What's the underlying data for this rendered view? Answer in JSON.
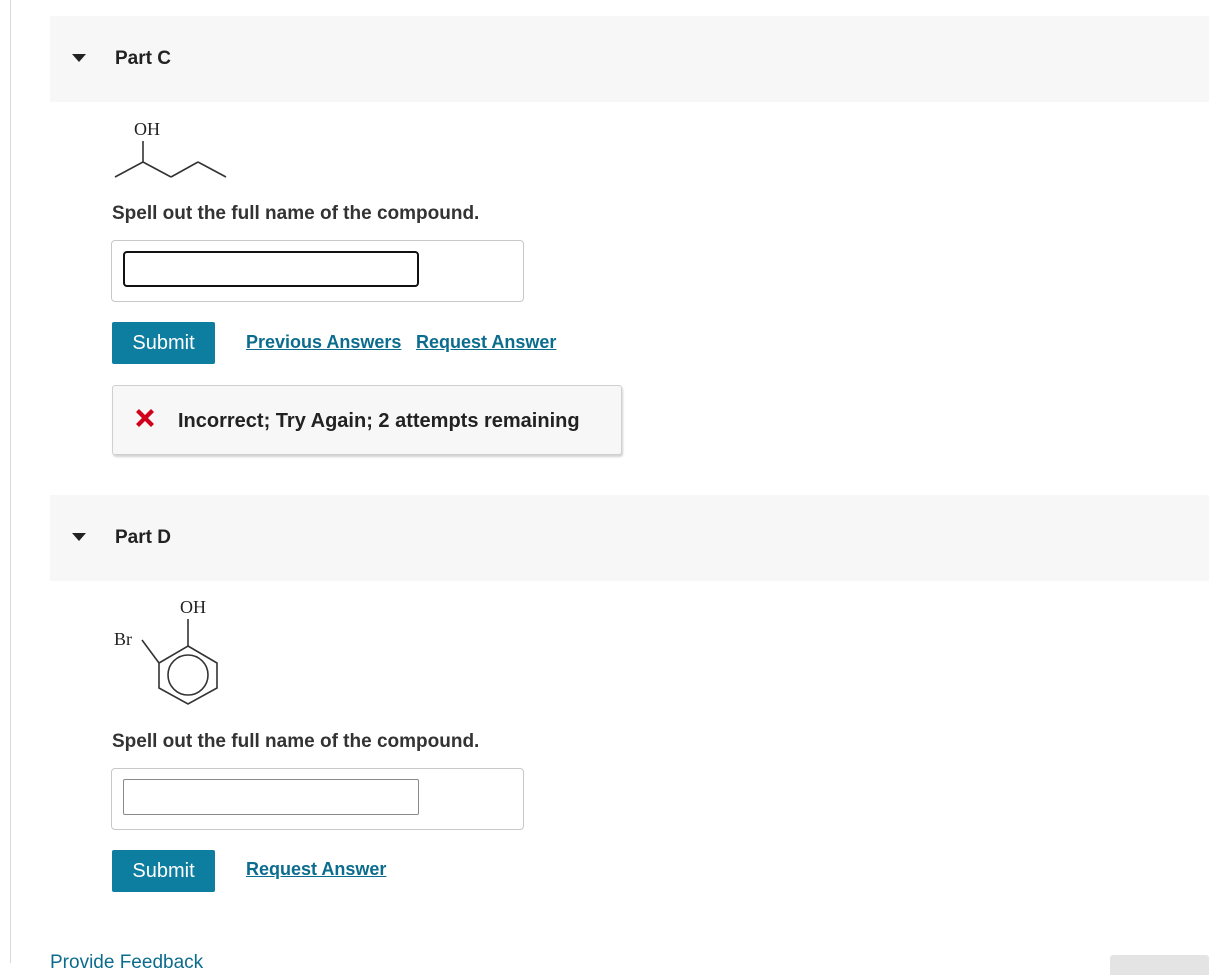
{
  "parts": [
    {
      "title": "Part C",
      "prompt": "Spell out the full name of the compound.",
      "input_value": "",
      "submit_label": "Submit",
      "previous_answers_label": "Previous Answers",
      "request_answer_label": "Request Answer",
      "feedback": "Incorrect; Try Again; 2 attempts remaining",
      "molecule_labels": [
        "OH"
      ]
    },
    {
      "title": "Part D",
      "prompt": "Spell out the full name of the compound.",
      "input_value": "",
      "submit_label": "Submit",
      "request_answer_label": "Request Answer",
      "molecule_labels": [
        "OH",
        "Br"
      ]
    }
  ],
  "footer": {
    "provide_feedback_label": "Provide Feedback"
  },
  "colors": {
    "accent": "#0e7ea0",
    "link": "#0b6c8e",
    "error": "#d0021b",
    "header_bg": "#f7f7f7"
  },
  "icons": [
    "caret-down-icon",
    "incorrect-x-icon"
  ]
}
